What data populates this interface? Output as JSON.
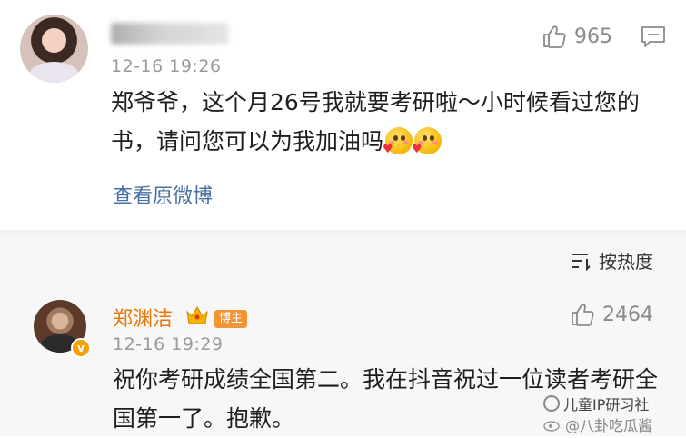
{
  "comment1": {
    "timestamp": "12-16 19:26",
    "like_count": "965",
    "text": "郑爷爷，这个月26号我就要考研啦～小时候看过您的书，请问您可以为我加油吗",
    "view_original_label": "查看原微博"
  },
  "sort": {
    "label": "按热度"
  },
  "comment2": {
    "username": "郑渊洁",
    "badge_label": "博主",
    "verified_mark": "v",
    "timestamp": "12-16 19:29",
    "like_count": "2464",
    "text": "祝你考研成绩全国第二。我在抖音祝过一位读者考研全国第一了。抱歉。"
  },
  "watermarks": {
    "line1": "儿童IP研习社",
    "line2": "@八卦吃瓜酱"
  },
  "colors": {
    "username_orange": "#e8790a",
    "link_blue": "#4a6fa5",
    "host_tag": "#f19436"
  }
}
